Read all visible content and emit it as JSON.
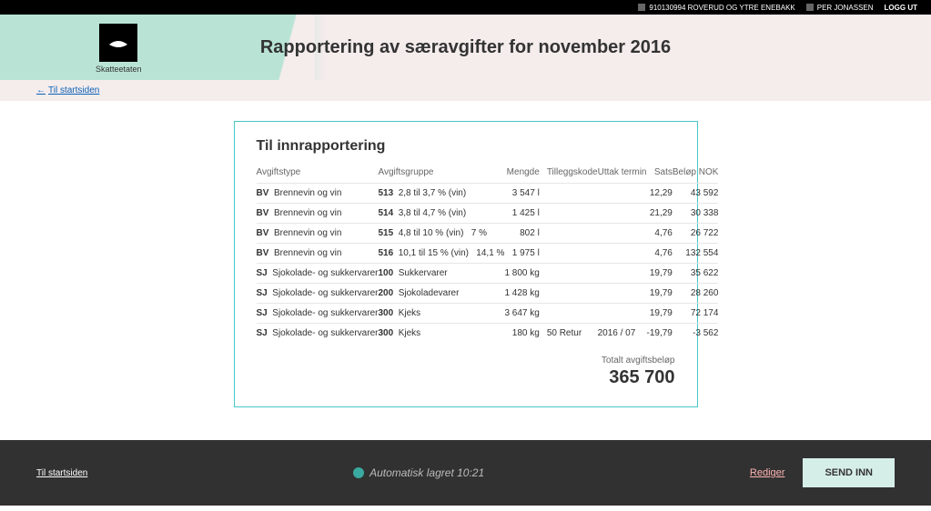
{
  "topbar": {
    "org_id": "910130994 ROVERUD OG YTRE ENEBAKK",
    "user": "PER JONASSEN",
    "logout": "LOGG UT"
  },
  "brand": "Skatteetaten",
  "page_title": "Rapportering av særavgifter for november 2016",
  "backlink": "Til startsiden",
  "card": {
    "heading": "Til innrapportering",
    "columns": {
      "c0": "Avgiftstype",
      "c1": "Avgiftsgruppe",
      "c2": "Mengde",
      "c3": "Tilleggskode",
      "c4": "Uttak termin",
      "c5": "Sats",
      "c6": "Beløp NOK"
    },
    "rows": [
      {
        "tcode": "BV",
        "tname": "Brennevin og vin",
        "gcode": "513",
        "gname": "2,8 til 3,7 % (vin)",
        "extra": "",
        "mengde": "3 547 l",
        "tillegg": "",
        "termin": "",
        "sats": "12,29",
        "belop": "43 592"
      },
      {
        "tcode": "BV",
        "tname": "Brennevin og vin",
        "gcode": "514",
        "gname": "3,8 til 4,7 % (vin)",
        "extra": "",
        "mengde": "1 425 l",
        "tillegg": "",
        "termin": "",
        "sats": "21,29",
        "belop": "30 338"
      },
      {
        "tcode": "BV",
        "tname": "Brennevin og vin",
        "gcode": "515",
        "gname": "4,8 til 10 % (vin)",
        "extra": "7 %",
        "mengde": "802 l",
        "tillegg": "",
        "termin": "",
        "sats": "4,76",
        "belop": "26 722"
      },
      {
        "tcode": "BV",
        "tname": "Brennevin og vin",
        "gcode": "516",
        "gname": "10,1 til 15 % (vin)",
        "extra": "14,1 %",
        "mengde": "1 975 l",
        "tillegg": "",
        "termin": "",
        "sats": "4,76",
        "belop": "132 554"
      },
      {
        "tcode": "SJ",
        "tname": "Sjokolade- og sukkervarer",
        "gcode": "100",
        "gname": "Sukkervarer",
        "extra": "",
        "mengde": "1 800 kg",
        "tillegg": "",
        "termin": "",
        "sats": "19,79",
        "belop": "35 622"
      },
      {
        "tcode": "SJ",
        "tname": "Sjokolade- og sukkervarer",
        "gcode": "200",
        "gname": "Sjokoladevarer",
        "extra": "",
        "mengde": "1 428 kg",
        "tillegg": "",
        "termin": "",
        "sats": "19,79",
        "belop": "28 260"
      },
      {
        "tcode": "SJ",
        "tname": "Sjokolade- og sukkervarer",
        "gcode": "300",
        "gname": "Kjeks",
        "extra": "",
        "mengde": "3 647 kg",
        "tillegg": "",
        "termin": "",
        "sats": "19,79",
        "belop": "72 174"
      },
      {
        "tcode": "SJ",
        "tname": "Sjokolade- og sukkervarer",
        "gcode": "300",
        "gname": "Kjeks",
        "extra": "",
        "mengde": "180 kg",
        "tillegg": "50 Retur",
        "termin": "2016 / 07",
        "sats": "-19,79",
        "belop": "-3 562"
      }
    ],
    "total_label": "Totalt avgiftsbeløp",
    "total_value": "365 700"
  },
  "footer": {
    "left_link": "Til startsiden",
    "autosave": "Automatisk lagret 10:21",
    "edit": "Rediger",
    "send": "SEND INN"
  }
}
